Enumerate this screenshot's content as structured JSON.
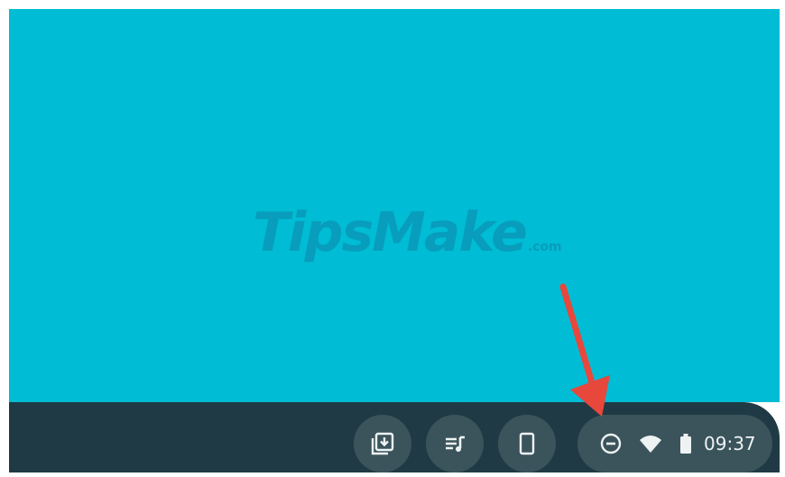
{
  "watermark": {
    "brand": "TipsMake",
    "suffix": ".com"
  },
  "shelf": {
    "pinned_apps": [
      {
        "icon": "download-icon"
      },
      {
        "icon": "playlist-icon"
      },
      {
        "icon": "phone-icon"
      }
    ],
    "status_tray": {
      "icons": [
        "do-not-disturb-icon",
        "wifi-icon",
        "battery-icon"
      ],
      "time": "09:37"
    }
  },
  "annotation": {
    "arrow_color": "#e8473c"
  },
  "colors": {
    "desktop": "#00bcd4",
    "shelf": "#1f3a44",
    "button": "#3b545c",
    "icon": "#eef2f3"
  }
}
